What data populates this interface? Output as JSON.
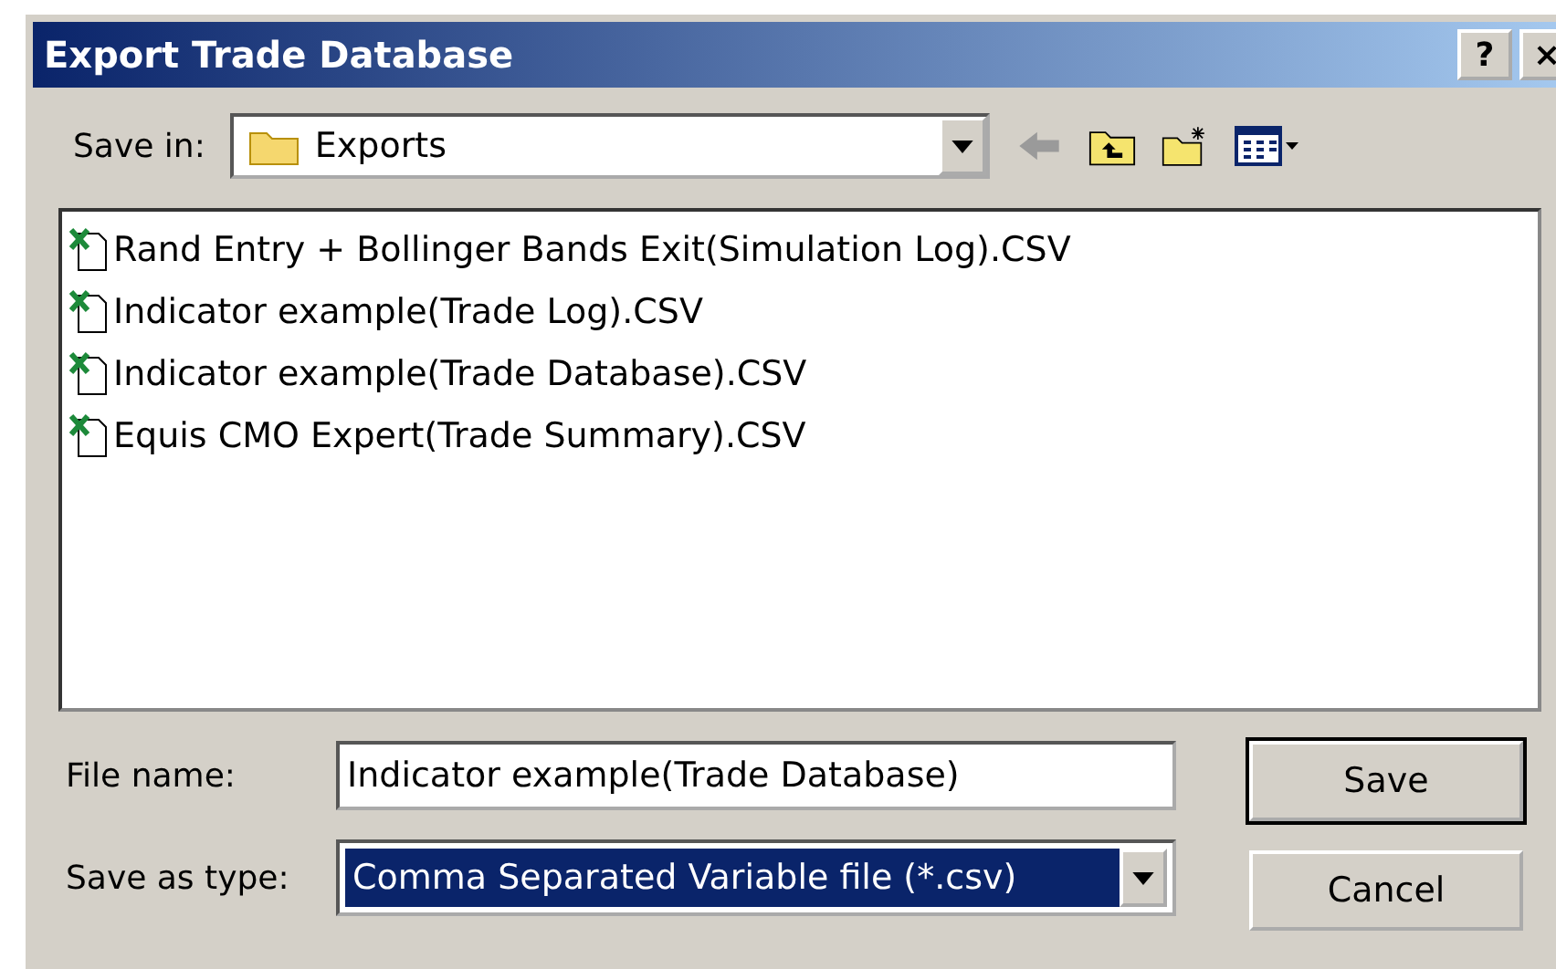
{
  "window": {
    "title": "Export Trade Database",
    "help_button": "?",
    "close_button": "×"
  },
  "save_in": {
    "label": "Save in:",
    "value": "Exports"
  },
  "files": [
    {
      "name": "Rand Entry + Bollinger Bands Exit(Simulation Log).CSV",
      "selected": false
    },
    {
      "name": "Indicator example(Trade Log).CSV",
      "selected": false
    },
    {
      "name": "Indicator example(Trade Database).CSV",
      "selected": false
    },
    {
      "name": "Equis CMO Expert(Trade Summary).CSV",
      "selected": false
    }
  ],
  "file_name": {
    "label": "File name:",
    "value": "Indicator example(Trade Database)"
  },
  "save_as_type": {
    "label": "Save as type:",
    "value": "Comma Separated Variable file (*.csv)"
  },
  "buttons": [
    {
      "label": "Save",
      "default": true
    },
    {
      "label": "Cancel",
      "default": false
    }
  ]
}
